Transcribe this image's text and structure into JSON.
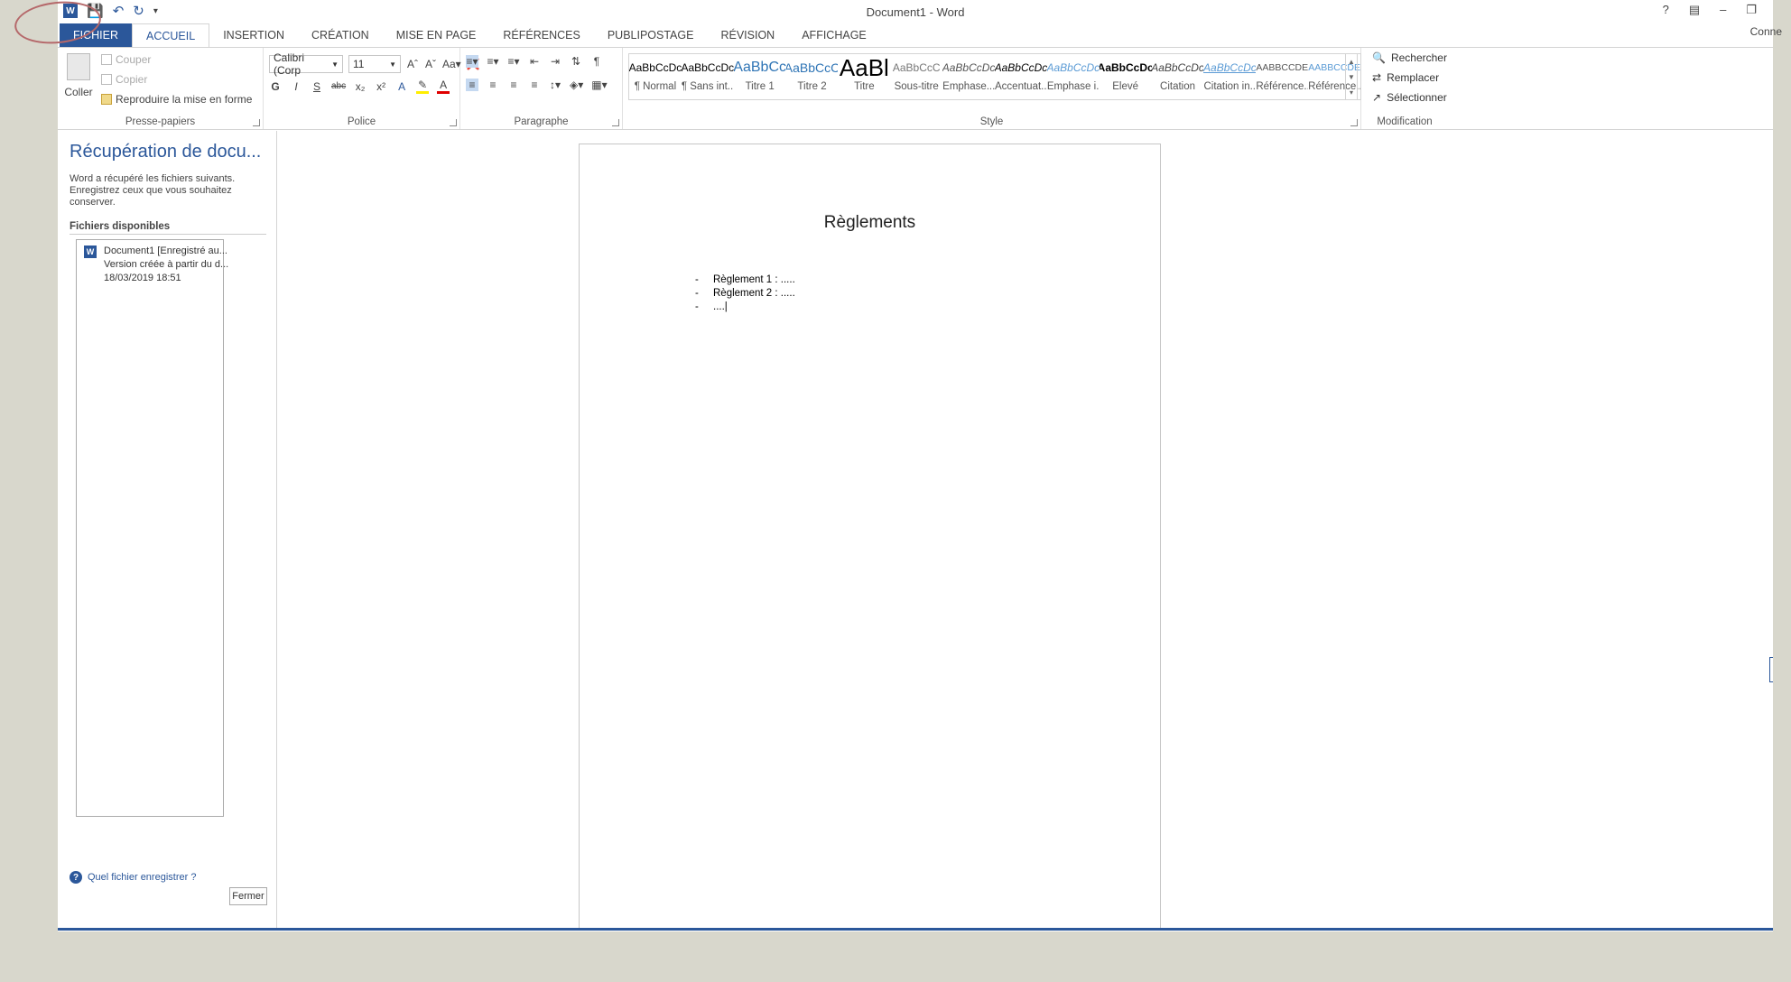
{
  "window": {
    "title": "Document1 - Word",
    "connect_label": "Conne"
  },
  "qat": {
    "undo_icon": "undo-icon",
    "redo_icon": "redo-icon"
  },
  "tabs": [
    "FICHIER",
    "ACCUEIL",
    "INSERTION",
    "CRÉATION",
    "MISE EN PAGE",
    "RÉFÉRENCES",
    "PUBLIPOSTAGE",
    "RÉVISION",
    "AFFICHAGE"
  ],
  "clipboard": {
    "paste": "Coller",
    "cut": "Couper",
    "copy": "Copier",
    "format_painter": "Reproduire la mise en forme",
    "label": "Presse-papiers"
  },
  "font": {
    "name": "Calibri (Corp",
    "size": "11",
    "label": "Police"
  },
  "paragraph": {
    "label": "Paragraphe"
  },
  "styles": {
    "label": "Style",
    "items": [
      {
        "preview": "AaBbCcDc",
        "name": "¶ Normal"
      },
      {
        "preview": "AaBbCcDc",
        "name": "¶ Sans int..."
      },
      {
        "preview": "AaBbCc",
        "name": "Titre 1"
      },
      {
        "preview": "AaBbCcC",
        "name": "Titre 2"
      },
      {
        "preview": "AaBl",
        "name": "Titre"
      },
      {
        "preview": "AaBbCcC",
        "name": "Sous-titre"
      },
      {
        "preview": "AaBbCcDc",
        "name": "Emphase..."
      },
      {
        "preview": "AaBbCcDc",
        "name": "Accentuat..."
      },
      {
        "preview": "AaBbCcDc",
        "name": "Emphase i..."
      },
      {
        "preview": "AaBbCcDc",
        "name": "Élevé"
      },
      {
        "preview": "AaBbCcDc",
        "name": "Citation"
      },
      {
        "preview": "AaBbCcDc",
        "name": "Citation in..."
      },
      {
        "preview": "AABBCCDE",
        "name": "Référence..."
      },
      {
        "preview": "AABBCCDE",
        "name": "Référence..."
      }
    ]
  },
  "editing": {
    "find": "Rechercher",
    "replace": "Remplacer",
    "select": "Sélectionner",
    "label": "Modification"
  },
  "recovery": {
    "title": "Récupération de docu...",
    "description": "Word a récupéré les fichiers suivants. Enregistrez ceux que vous souhaitez conserver.",
    "available": "Fichiers disponibles",
    "file_line1": "Document1  [Enregistré au...",
    "file_line2": "Version créée à partir du d...",
    "file_line3": "18/03/2019 18:51",
    "help": "Quel fichier enregistrer ?",
    "close": "Fermer"
  },
  "document": {
    "heading": "Règlements",
    "items": [
      "Règlement 1 : .....",
      "Règlement 2 : .....",
      "....|"
    ]
  }
}
